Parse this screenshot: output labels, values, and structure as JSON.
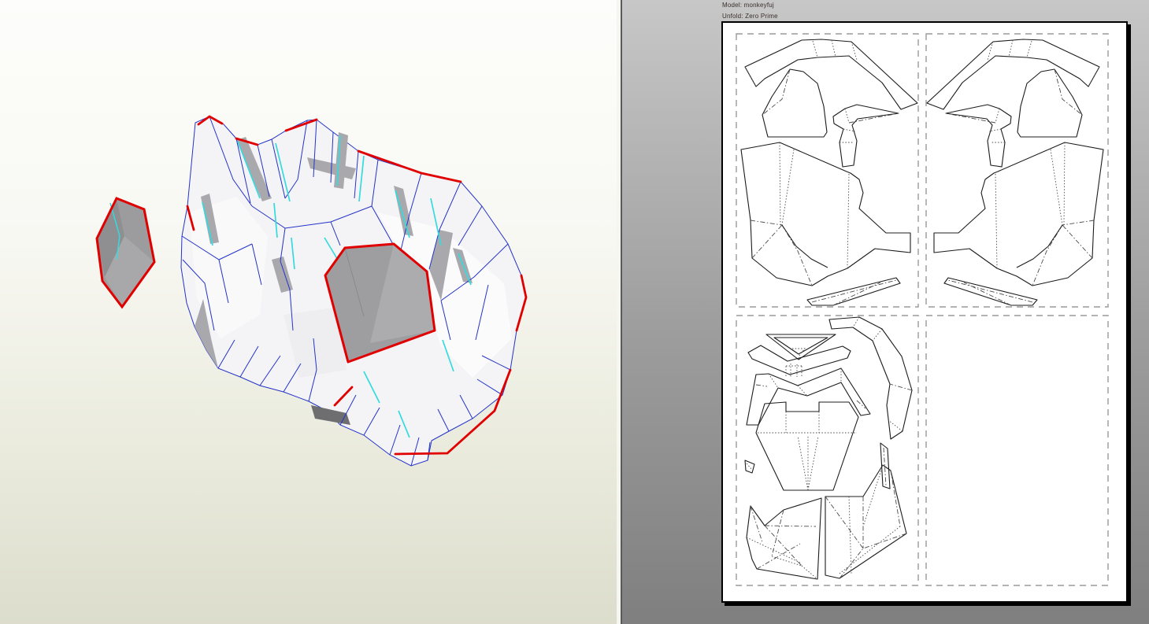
{
  "window": {
    "app_kind": "papercraft-unfold-editor",
    "panes": [
      "3d-model-view",
      "unfolded-pattern-view"
    ]
  },
  "header": {
    "model_line": "Model: monkeyfuj",
    "unfold_line": "Unfold: Zero Prime",
    "model_label": "Model:",
    "model_value": "monkeyfuj",
    "unfold_label": "Unfold:",
    "unfold_value": "Zero Prime"
  },
  "viewport3d": {
    "background_top": "#fdfdfb",
    "background_bottom": "#dcddcc",
    "face_color": "#f4f4f5",
    "shaded_face_color": "#9e9ea1",
    "edge_color_mesh": "#2433c8",
    "edge_color_open": "#35dade",
    "edge_color_boundary": "#e00000"
  },
  "pattern_view": {
    "pane_background_top": "#c7c7c7",
    "pane_background_bottom": "#7f7f7f",
    "sheet_color": "#ffffff",
    "page_count": 4,
    "pages_with_parts": 3,
    "page_margin_style": "dashed",
    "line_styles": {
      "cut": "solid",
      "valley_fold": "dotted",
      "mountain_fold": "dash-dot"
    }
  }
}
